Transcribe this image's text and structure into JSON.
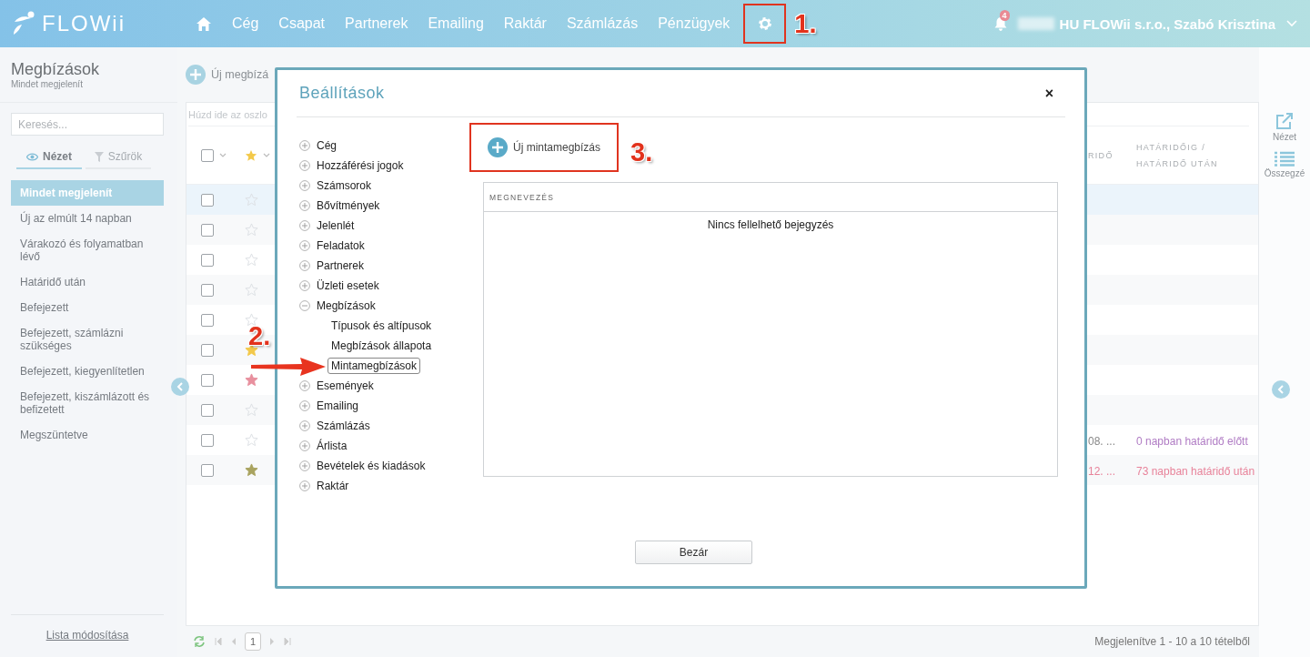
{
  "topbar": {
    "logo": "FLOWii",
    "nav": [
      {
        "kind": "home"
      },
      {
        "kind": "link",
        "label": "Cég"
      },
      {
        "kind": "link",
        "label": "Csapat"
      },
      {
        "kind": "link",
        "label": "Partnerek"
      },
      {
        "kind": "link",
        "label": "Emailing"
      },
      {
        "kind": "link",
        "label": "Raktár"
      },
      {
        "kind": "link",
        "label": "Számlázás"
      },
      {
        "kind": "link",
        "label": "Pénzügyek"
      },
      {
        "kind": "settings",
        "highlighted": true,
        "callout": "1."
      }
    ],
    "notifications": "4",
    "account": "HU FLOWii s.r.o., Szabó Krisztina"
  },
  "sidebar": {
    "title": "Megbízások",
    "subtitle": "Mindet megjelenít",
    "search": {
      "placeholder": "Keresés..."
    },
    "tabs": [
      {
        "label": "Nézet",
        "kind": "view",
        "selected": true
      },
      {
        "label": "Szűrök",
        "kind": "filter",
        "selected": false
      }
    ],
    "items": [
      {
        "label": "Mindet megjelenít",
        "selected": true
      },
      {
        "label": "Új az elmúlt 14 napban",
        "selected": false
      },
      {
        "label": "Várakozó és folyamatban lévő",
        "selected": false
      },
      {
        "label": "Határidő után",
        "selected": false
      },
      {
        "label": "Befejezett",
        "selected": false
      },
      {
        "label": "Befejezett, számlázni szükséges",
        "selected": false
      },
      {
        "label": "Befejezett, kiegyenlítetlen",
        "selected": false
      },
      {
        "label": "Befejezett, kiszámlázott és befizetett",
        "selected": false
      },
      {
        "label": "Megszüntetve",
        "selected": false
      }
    ],
    "footer_link": "Lista módosítása"
  },
  "toolbar": {
    "new_button": "Új megbízá"
  },
  "table": {
    "group_hint": "Húzd ide az oszlo",
    "header_checked": false,
    "columns": [
      {
        "kind": "select"
      },
      {
        "kind": "star"
      },
      {
        "kind": "text",
        "label": "RIDŐ"
      },
      {
        "kind": "text",
        "label": "HATÁRIDŐIG / HATÁRIDŐ UTÁN"
      }
    ],
    "rows": [
      {
        "selected": true,
        "checked": false,
        "starred": false
      },
      {
        "selected": false,
        "checked": false,
        "starred": false
      },
      {
        "selected": false,
        "checked": false,
        "starred": false
      },
      {
        "selected": false,
        "checked": false,
        "starred": false
      },
      {
        "selected": false,
        "checked": false,
        "starred": false
      },
      {
        "selected": false,
        "checked": false,
        "starred": true,
        "color": "#f3c94a"
      },
      {
        "selected": false,
        "checked": false,
        "starred": true,
        "color": "#e8909e"
      },
      {
        "selected": false,
        "checked": false,
        "starred": false
      },
      {
        "selected": false,
        "checked": false,
        "starred": false,
        "date": "08. ...",
        "deadline": "0 napban határidő előtt",
        "overdue": false
      },
      {
        "selected": false,
        "checked": false,
        "starred": true,
        "color": "#a9a35f",
        "date": "12. ...",
        "deadline": "73 napban határidő után",
        "overdue": true
      }
    ]
  },
  "pager": {
    "page": "1",
    "summary": "Megjelenítve 1 - 10 a 10 tételből"
  },
  "right_panel": [
    {
      "kind": "view",
      "label": "Nézet"
    },
    {
      "kind": "summary",
      "label": "Összegzé"
    }
  ],
  "dialog": {
    "title": "Beállítások",
    "close": "×",
    "tree": [
      {
        "label": "Cég",
        "expanded": false,
        "selected": false
      },
      {
        "label": "Hozzáférési jogok",
        "expanded": false,
        "selected": false
      },
      {
        "label": "Számsorok",
        "expanded": false,
        "selected": false
      },
      {
        "label": "Bővítmények",
        "expanded": false,
        "selected": false
      },
      {
        "label": "Jelenlét",
        "expanded": false,
        "selected": false
      },
      {
        "label": "Feladatok",
        "expanded": false,
        "selected": false
      },
      {
        "label": "Partnerek",
        "expanded": false,
        "selected": false
      },
      {
        "label": "Üzleti esetek",
        "expanded": false,
        "selected": false
      },
      {
        "label": "Megbízások",
        "expanded": true,
        "selected": false,
        "children": [
          {
            "label": "Típusok és altípusok",
            "selected": false
          },
          {
            "label": "Megbízások állapota",
            "selected": false
          },
          {
            "label": "Mintamegbízások",
            "selected": true,
            "callout": "2."
          }
        ]
      },
      {
        "label": "Események",
        "expanded": false,
        "selected": false
      },
      {
        "label": "Emailing",
        "expanded": false,
        "selected": false
      },
      {
        "label": "Számlázás",
        "expanded": false,
        "selected": false
      },
      {
        "label": "Árlista",
        "expanded": false,
        "selected": false
      },
      {
        "label": "Bevételek és kiadások",
        "expanded": false,
        "selected": false
      },
      {
        "label": "Raktár",
        "expanded": false,
        "selected": false
      }
    ],
    "new_button": {
      "label": "Új mintamegbízás",
      "highlighted": true,
      "callout": "3."
    },
    "list": {
      "column": "MEGNEVEZÉS",
      "empty": "Nincs fellelhető bejegyzés"
    },
    "close_button": "Bezár"
  }
}
